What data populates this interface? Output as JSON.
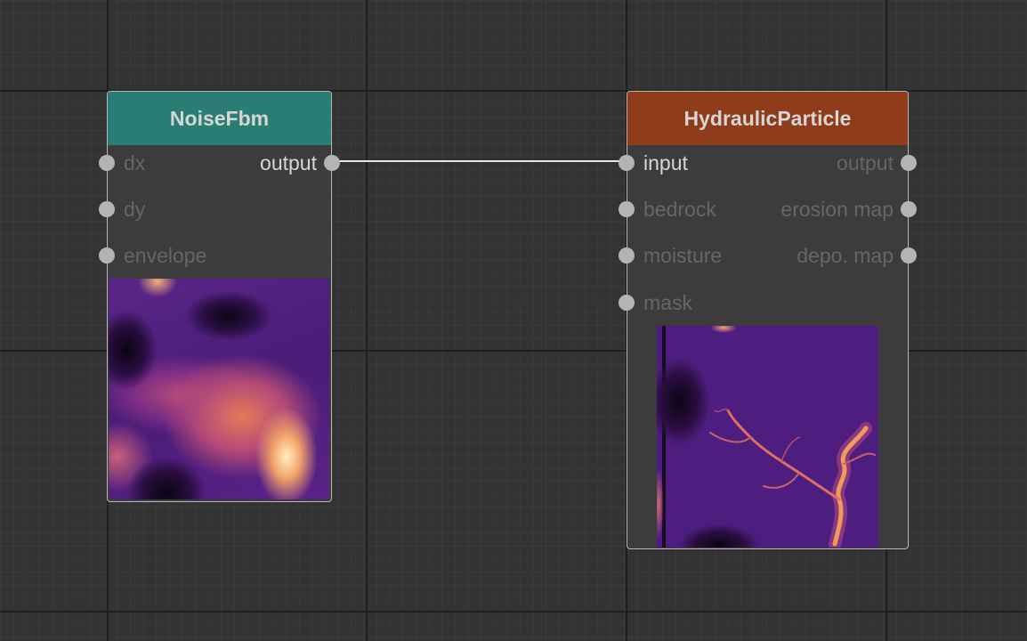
{
  "colors": {
    "noise_header": "#2a7d74",
    "hydraulic_header": "#8f3c1a",
    "link": "#e6e6e6",
    "port": "#b4b4b4"
  },
  "nodes": {
    "noisefbm": {
      "title": "NoiseFbm",
      "inputs": [
        "dx",
        "dy",
        "envelope"
      ],
      "outputs": [
        "output"
      ]
    },
    "hydraulic": {
      "title": "HydraulicParticle",
      "inputs": [
        "input",
        "bedrock",
        "moisture",
        "mask"
      ],
      "outputs": [
        "output",
        "erosion map",
        "depo. map"
      ]
    }
  },
  "links": [
    {
      "from": "NoiseFbm.output",
      "to": "HydraulicParticle.input"
    }
  ]
}
